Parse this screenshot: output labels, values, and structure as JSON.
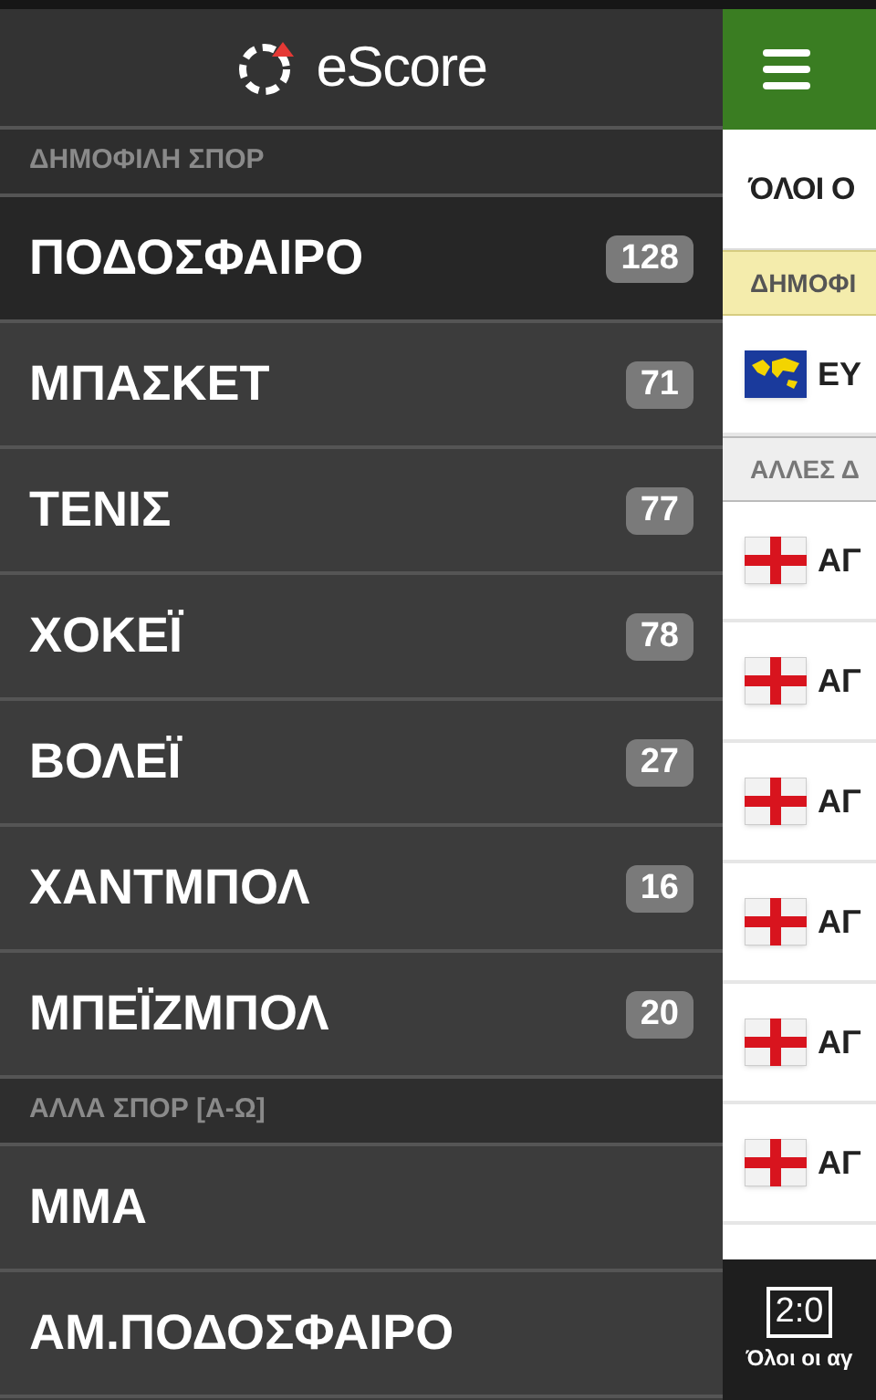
{
  "sidebar": {
    "logo": "eScore",
    "sections": [
      {
        "title": "ΔΗΜΟΦΙΛΗ ΣΠΟΡ",
        "items": [
          {
            "label": "ΠΟΔΟΣΦΑΙΡΟ",
            "count": "128",
            "selected": true
          },
          {
            "label": "ΜΠΑΣΚΕΤ",
            "count": "71",
            "selected": false
          },
          {
            "label": "ΤΕΝΙΣ",
            "count": "77",
            "selected": false
          },
          {
            "label": "ΧΟΚΕΪ",
            "count": "78",
            "selected": false
          },
          {
            "label": "ΒΟΛΕΪ",
            "count": "27",
            "selected": false
          },
          {
            "label": "ΧΑΝΤΜΠΟΛ",
            "count": "16",
            "selected": false
          },
          {
            "label": "ΜΠΕΪΖΜΠΟΛ",
            "count": "20",
            "selected": false
          }
        ]
      },
      {
        "title": "ΑΛΛΑ ΣΠΟΡ [Α-Ω]",
        "items": [
          {
            "label": "ΜΜΑ",
            "selected": false
          },
          {
            "label": "ΑΜ.ΠΟΔΟΣΦΑΙΡΟ",
            "selected": false
          }
        ]
      }
    ]
  },
  "main": {
    "filter": "ΌΛΟΙ Ο",
    "sections": [
      {
        "title": "ΔΗΜΟΦΙ",
        "kind": "popular",
        "rows": [
          {
            "kind": "world",
            "label": "ΕΥ"
          }
        ]
      },
      {
        "title": "ΑΛΛΕΣ Δ",
        "kind": "other",
        "rows": [
          {
            "kind": "england",
            "label": "ΑΓ"
          },
          {
            "kind": "england",
            "label": "ΑΓ"
          },
          {
            "kind": "england",
            "label": "ΑΓ"
          },
          {
            "kind": "england",
            "label": "ΑΓ"
          },
          {
            "kind": "england",
            "label": "ΑΓ"
          },
          {
            "kind": "england",
            "label": "ΑΓ"
          }
        ]
      }
    ]
  },
  "bottom_tab": {
    "score": "2:0",
    "label": "Όλοι οι αγ"
  }
}
